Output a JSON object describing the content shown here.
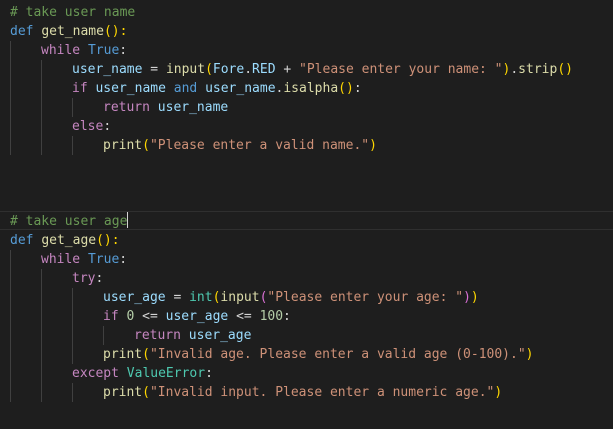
{
  "editor": {
    "theme": {
      "background": "#1e1e1e",
      "comment": "#6a9955",
      "keyword": "#569cd6",
      "control": "#c586c0",
      "function": "#dcdcaa",
      "variable": "#9cdcfe",
      "string": "#ce9178",
      "number": "#b5cea8",
      "class": "#4ec9b0",
      "plain": "#d4d4d4"
    },
    "lines": [
      {
        "indent": 0,
        "tokens": [
          {
            "t": "# take user name",
            "c": "comment"
          }
        ]
      },
      {
        "indent": 0,
        "tokens": [
          {
            "t": "def",
            "c": "keyword"
          },
          {
            "t": " ",
            "c": "plain"
          },
          {
            "t": "get_name",
            "c": "func"
          },
          {
            "t": "():",
            "c": "br1"
          }
        ]
      },
      {
        "indent": 1,
        "tokens": [
          {
            "t": "while",
            "c": "control"
          },
          {
            "t": " ",
            "c": "plain"
          },
          {
            "t": "True",
            "c": "keyword"
          },
          {
            "t": ":",
            "c": "plain"
          }
        ]
      },
      {
        "indent": 2,
        "tokens": [
          {
            "t": "user_name",
            "c": "var"
          },
          {
            "t": " = ",
            "c": "plain"
          },
          {
            "t": "input",
            "c": "func"
          },
          {
            "t": "(",
            "c": "br1"
          },
          {
            "t": "Fore",
            "c": "var"
          },
          {
            "t": ".",
            "c": "plain"
          },
          {
            "t": "RED",
            "c": "var"
          },
          {
            "t": " + ",
            "c": "plain"
          },
          {
            "t": "\"Please enter your name: \"",
            "c": "string"
          },
          {
            "t": ")",
            "c": "br1"
          },
          {
            "t": ".",
            "c": "plain"
          },
          {
            "t": "strip",
            "c": "func"
          },
          {
            "t": "()",
            "c": "br1"
          }
        ]
      },
      {
        "indent": 2,
        "tokens": [
          {
            "t": "if",
            "c": "control"
          },
          {
            "t": " ",
            "c": "plain"
          },
          {
            "t": "user_name",
            "c": "var"
          },
          {
            "t": " ",
            "c": "plain"
          },
          {
            "t": "and",
            "c": "keyword"
          },
          {
            "t": " ",
            "c": "plain"
          },
          {
            "t": "user_name",
            "c": "var"
          },
          {
            "t": ".",
            "c": "plain"
          },
          {
            "t": "isalpha",
            "c": "func"
          },
          {
            "t": "()",
            "c": "br1"
          },
          {
            "t": ":",
            "c": "plain"
          }
        ]
      },
      {
        "indent": 3,
        "tokens": [
          {
            "t": "return",
            "c": "control"
          },
          {
            "t": " ",
            "c": "plain"
          },
          {
            "t": "user_name",
            "c": "var"
          }
        ]
      },
      {
        "indent": 2,
        "tokens": [
          {
            "t": "else",
            "c": "control"
          },
          {
            "t": ":",
            "c": "plain"
          }
        ]
      },
      {
        "indent": 3,
        "tokens": [
          {
            "t": "print",
            "c": "func"
          },
          {
            "t": "(",
            "c": "br1"
          },
          {
            "t": "\"Please enter a valid name.\"",
            "c": "string"
          },
          {
            "t": ")",
            "c": "br1"
          }
        ]
      },
      {
        "indent": 0,
        "tokens": []
      },
      {
        "indent": 0,
        "tokens": []
      },
      {
        "indent": 0,
        "tokens": []
      },
      {
        "indent": 0,
        "tokens": [
          {
            "t": "# take user age",
            "c": "comment"
          }
        ],
        "cursor": true
      },
      {
        "indent": 0,
        "tokens": [
          {
            "t": "def",
            "c": "keyword"
          },
          {
            "t": " ",
            "c": "plain"
          },
          {
            "t": "get_age",
            "c": "func"
          },
          {
            "t": "():",
            "c": "br1"
          }
        ]
      },
      {
        "indent": 1,
        "tokens": [
          {
            "t": "while",
            "c": "control"
          },
          {
            "t": " ",
            "c": "plain"
          },
          {
            "t": "True",
            "c": "keyword"
          },
          {
            "t": ":",
            "c": "plain"
          }
        ]
      },
      {
        "indent": 2,
        "tokens": [
          {
            "t": "try",
            "c": "control"
          },
          {
            "t": ":",
            "c": "plain"
          }
        ]
      },
      {
        "indent": 3,
        "tokens": [
          {
            "t": "user_age",
            "c": "var"
          },
          {
            "t": " = ",
            "c": "plain"
          },
          {
            "t": "int",
            "c": "class"
          },
          {
            "t": "(",
            "c": "br1"
          },
          {
            "t": "input",
            "c": "func"
          },
          {
            "t": "(",
            "c": "br2"
          },
          {
            "t": "\"Please enter your age: \"",
            "c": "string"
          },
          {
            "t": ")",
            "c": "br2"
          },
          {
            "t": ")",
            "c": "br1"
          }
        ]
      },
      {
        "indent": 3,
        "tokens": [
          {
            "t": "if",
            "c": "control"
          },
          {
            "t": " ",
            "c": "plain"
          },
          {
            "t": "0",
            "c": "number"
          },
          {
            "t": " <= ",
            "c": "plain"
          },
          {
            "t": "user_age",
            "c": "var"
          },
          {
            "t": " <= ",
            "c": "plain"
          },
          {
            "t": "100",
            "c": "number"
          },
          {
            "t": ":",
            "c": "plain"
          }
        ]
      },
      {
        "indent": 4,
        "tokens": [
          {
            "t": "return",
            "c": "control"
          },
          {
            "t": " ",
            "c": "plain"
          },
          {
            "t": "user_age",
            "c": "var"
          }
        ]
      },
      {
        "indent": 3,
        "tokens": [
          {
            "t": "print",
            "c": "func"
          },
          {
            "t": "(",
            "c": "br1"
          },
          {
            "t": "\"Invalid age. Please enter a valid age (0-100).\"",
            "c": "string"
          },
          {
            "t": ")",
            "c": "br1"
          }
        ]
      },
      {
        "indent": 2,
        "tokens": [
          {
            "t": "except",
            "c": "control"
          },
          {
            "t": " ",
            "c": "plain"
          },
          {
            "t": "ValueError",
            "c": "class"
          },
          {
            "t": ":",
            "c": "plain"
          }
        ]
      },
      {
        "indent": 3,
        "tokens": [
          {
            "t": "print",
            "c": "func"
          },
          {
            "t": "(",
            "c": "br1"
          },
          {
            "t": "\"Invalid input. Please enter a numeric age.\"",
            "c": "string"
          },
          {
            "t": ")",
            "c": "br1"
          }
        ]
      }
    ]
  }
}
